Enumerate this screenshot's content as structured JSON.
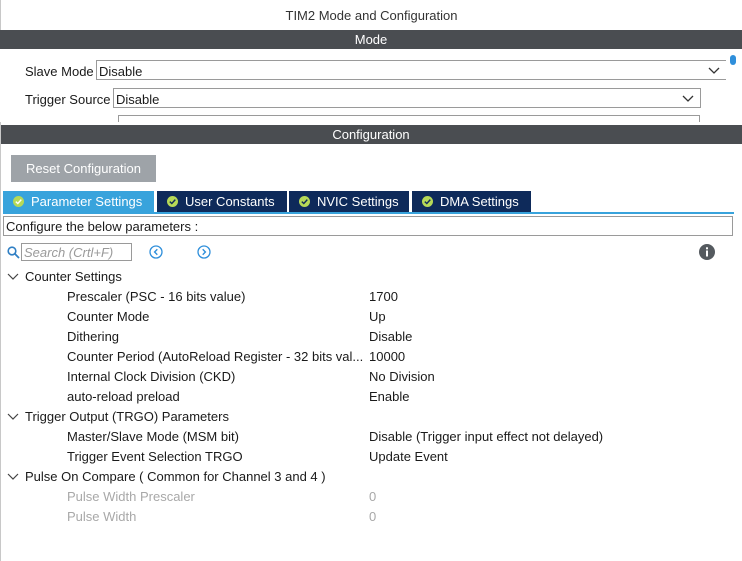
{
  "window": {
    "title": "TIM2 Mode and Configuration"
  },
  "mode": {
    "header": "Mode",
    "slave_mode": {
      "label": "Slave Mode",
      "value": "Disable"
    },
    "trigger_source": {
      "label": "Trigger Source",
      "value": "Disable"
    }
  },
  "configuration": {
    "header": "Configuration",
    "reset_label": "Reset Configuration",
    "tabs": [
      {
        "label": "Parameter Settings",
        "active": true
      },
      {
        "label": "User Constants",
        "active": false
      },
      {
        "label": "NVIC Settings",
        "active": false
      },
      {
        "label": "DMA Settings",
        "active": false
      }
    ],
    "hint": "Configure the below parameters :",
    "search": {
      "placeholder": "Search (Crtl+F)"
    }
  },
  "groups": [
    {
      "label": "Counter Settings",
      "params": [
        {
          "name": "Prescaler (PSC - 16 bits value)",
          "value": "1700"
        },
        {
          "name": "Counter Mode",
          "value": "Up"
        },
        {
          "name": "Dithering",
          "value": "Disable"
        },
        {
          "name": "Counter Period (AutoReload Register - 32 bits val...",
          "value": "10000"
        },
        {
          "name": "Internal Clock Division (CKD)",
          "value": "No Division"
        },
        {
          "name": "auto-reload preload",
          "value": "Enable"
        }
      ]
    },
    {
      "label": "Trigger Output (TRGO) Parameters",
      "params": [
        {
          "name": "Master/Slave Mode (MSM bit)",
          "value": "Disable (Trigger input effect not delayed)"
        },
        {
          "name": "Trigger Event Selection TRGO",
          "value": "Update Event"
        }
      ]
    },
    {
      "label": "Pulse On Compare ( Common for Channel 3 and 4 )",
      "params": [
        {
          "name": "Pulse Width Prescaler",
          "value": "0"
        },
        {
          "name": "Pulse Width",
          "value": "0"
        }
      ]
    }
  ],
  "colors": {
    "header_bar": "#4a4d51",
    "tab_active": "#38a3dc",
    "tab_inactive": "#0e2a5a",
    "check": "#b6d957",
    "disabled_text": "#a8a8a8"
  }
}
